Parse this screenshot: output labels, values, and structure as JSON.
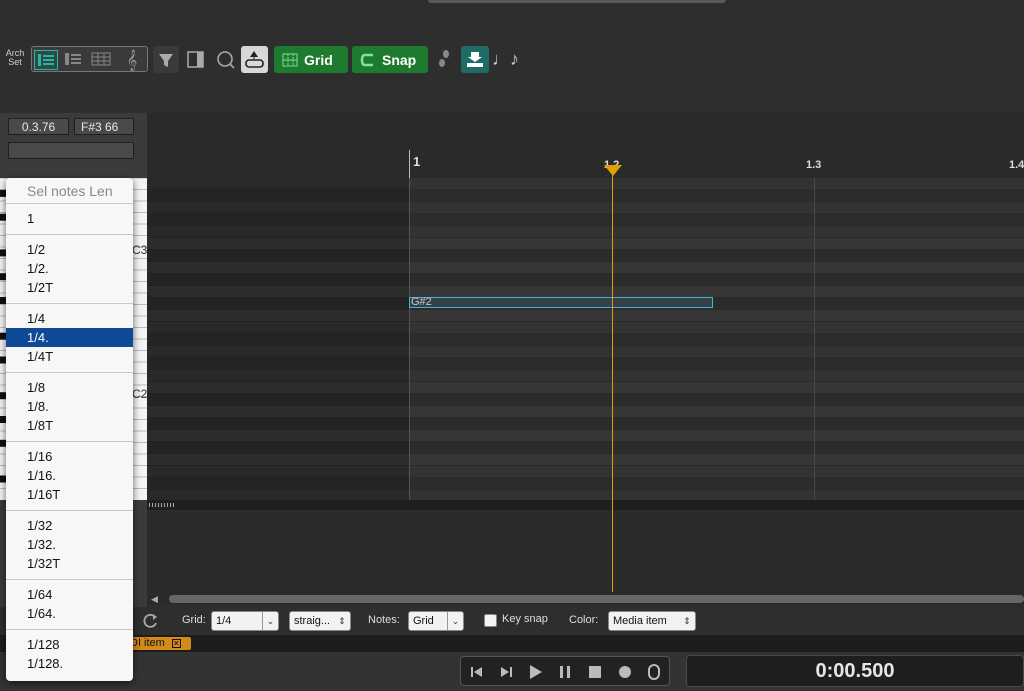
{
  "toolbar": {
    "arch_line1": "Arch",
    "arch_line2": "Set",
    "grid_label": "Grid",
    "snap_label": "Snap"
  },
  "sidebar": {
    "position": "0.3.76",
    "note_info": "F#3  66"
  },
  "piano": {
    "c3_label": "C3",
    "c2_label": "C2"
  },
  "ruler": {
    "m1": "1",
    "m1_2": "1.2",
    "m1_3": "1.3",
    "m1_4": "1.4"
  },
  "note": {
    "label": "G#2"
  },
  "bottom": {
    "grid_label": "Grid:",
    "grid_value": "1/4",
    "grid_type": "straig...",
    "notes_label": "Notes:",
    "notes_value": "Grid",
    "keysnap_label": "Key snap",
    "color_label": "Color:",
    "color_value": "Media item"
  },
  "tab": {
    "item_label": "DI item"
  },
  "transport": {
    "time": "0:00.500"
  },
  "menu": {
    "header": "Sel notes Len",
    "groups": [
      [
        "1"
      ],
      [
        "1/2",
        "1/2.",
        "1/2T"
      ],
      [
        "1/4",
        "1/4.",
        "1/4T"
      ],
      [
        "1/8",
        "1/8.",
        "1/8T"
      ],
      [
        "1/16",
        "1/16.",
        "1/16T"
      ],
      [
        "1/32",
        "1/32.",
        "1/32T"
      ],
      [
        "1/64",
        "1/64."
      ],
      [
        "1/128",
        "1/128."
      ]
    ],
    "selected": "1/4."
  },
  "colors": {
    "accent_green": "#1e7a2d",
    "teal": "#2bb5a5",
    "cursor": "#e0a000",
    "note_border": "#3fb4d8",
    "menu_highlight": "#0f4a96"
  }
}
